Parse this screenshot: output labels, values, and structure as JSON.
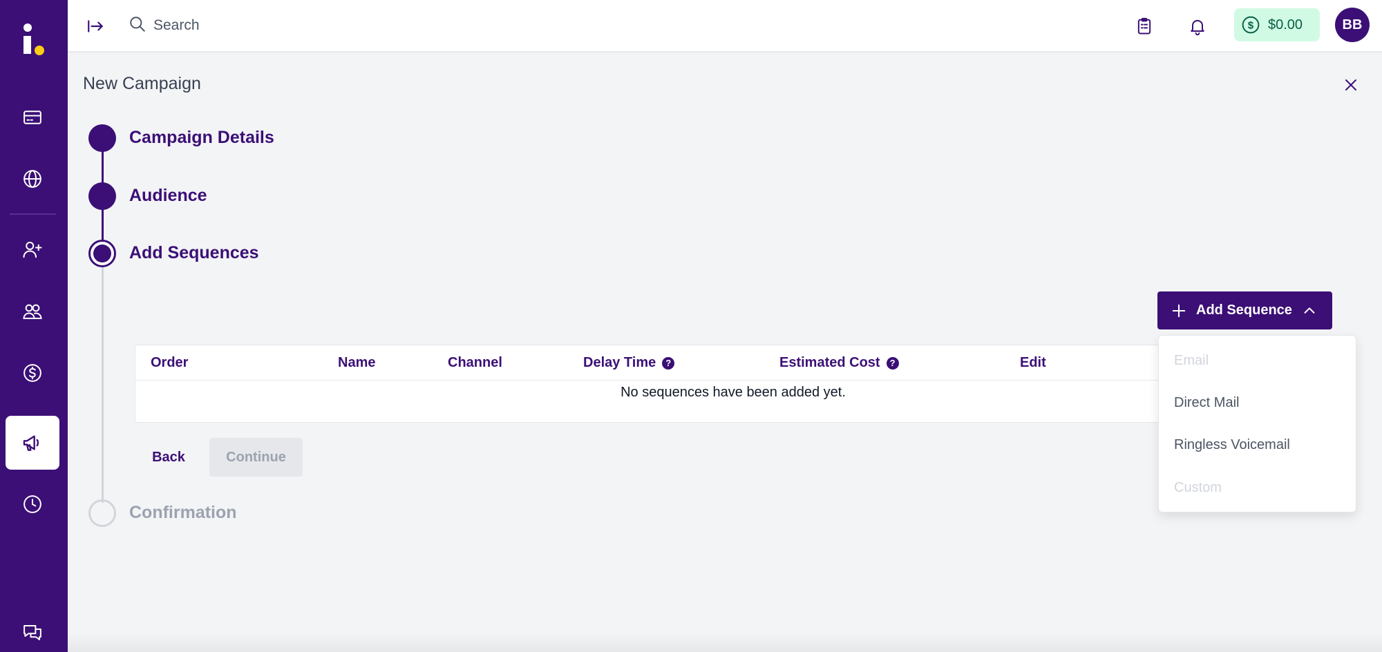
{
  "header": {
    "search_placeholder": "Search",
    "balance": "$0.00",
    "avatar_initials": "BB"
  },
  "page": {
    "title": "New Campaign"
  },
  "stepper": {
    "steps": [
      {
        "label": "Campaign Details",
        "state": "done"
      },
      {
        "label": "Audience",
        "state": "done"
      },
      {
        "label": "Add Sequences",
        "state": "current"
      },
      {
        "label": "Confirmation",
        "state": "pending"
      }
    ]
  },
  "add_sequence": {
    "label": "Add Sequence",
    "menu": [
      {
        "label": "Email",
        "disabled": true
      },
      {
        "label": "Direct Mail",
        "disabled": false
      },
      {
        "label": "Ringless Voicemail",
        "disabled": false
      },
      {
        "label": "Custom",
        "disabled": true
      }
    ]
  },
  "table": {
    "columns": [
      "Order",
      "Name",
      "Channel",
      "Delay Time",
      "Estimated Cost",
      "Edit"
    ],
    "help_glyph": "?",
    "empty_message": "No sequences have been added yet."
  },
  "actions": {
    "back": "Back",
    "continue": "Continue"
  },
  "colors": {
    "brand": "#3b0f76",
    "balance_bg": "#d1fae5",
    "balance_text": "#065f46"
  }
}
